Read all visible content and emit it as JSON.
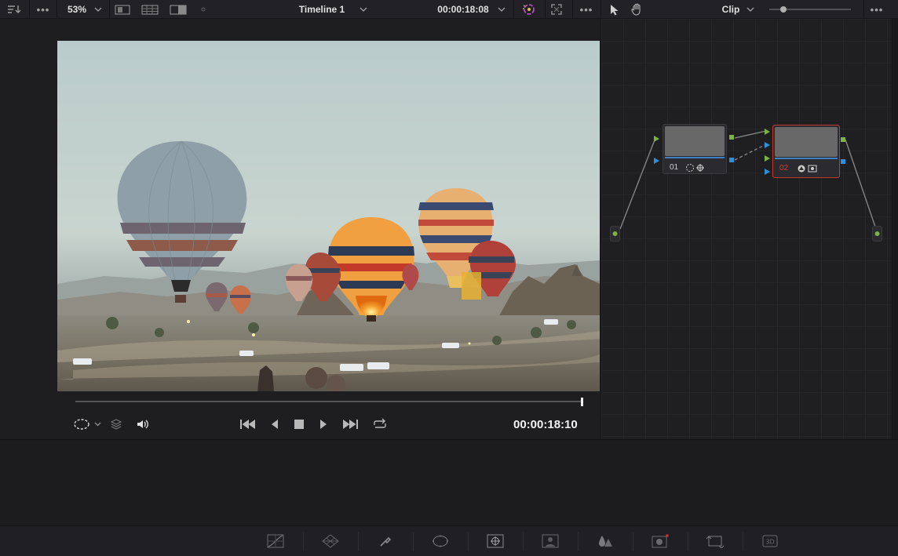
{
  "topbar": {
    "zoom": "53%",
    "timeline_name": "Timeline 1",
    "timecode": "00:00:18:08",
    "clip_mode": "Clip"
  },
  "transport": {
    "timecode": "00:00:18:10"
  },
  "nodes": [
    {
      "label": "01",
      "color": "#d0d0d0"
    },
    {
      "label": "02",
      "color": "#e23b2e"
    }
  ],
  "palettes": [
    {
      "name": "curves-icon"
    },
    {
      "name": "color-warper-icon"
    },
    {
      "name": "qualifier-icon"
    },
    {
      "name": "window-icon"
    },
    {
      "name": "tracker-icon"
    },
    {
      "name": "magic-mask-icon"
    },
    {
      "name": "blur-icon"
    },
    {
      "name": "key-icon"
    },
    {
      "name": "sizing-icon"
    },
    {
      "name": "3d-icon"
    }
  ],
  "colors": {
    "node_selected_border": "#c0392b",
    "input_green": "#7cb342",
    "output_blue": "#2f8fd8"
  }
}
